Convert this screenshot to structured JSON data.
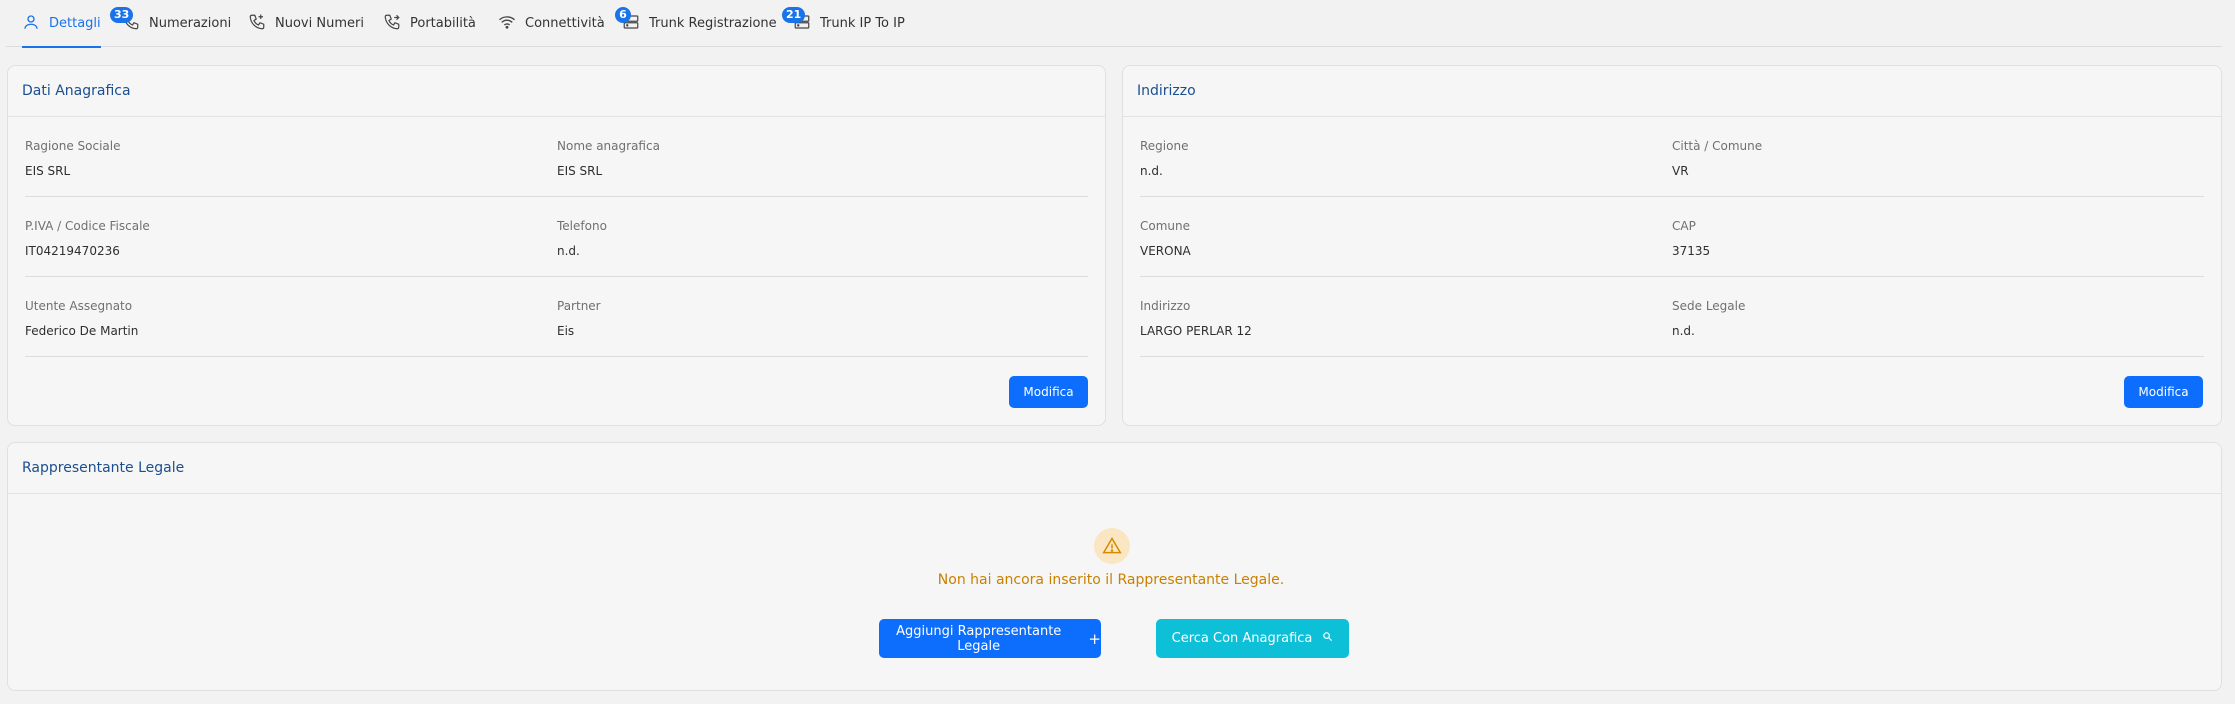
{
  "tabs": [
    {
      "label": "Dettagli",
      "icon": "user-icon",
      "badge": ""
    },
    {
      "label": "Numerazioni",
      "icon": "phone-icon",
      "badge": "33"
    },
    {
      "label": "Nuovi Numeri",
      "icon": "phone-plus-icon",
      "badge": ""
    },
    {
      "label": "Portabilità",
      "icon": "phone-forward-icon",
      "badge": ""
    },
    {
      "label": "Connettività",
      "icon": "wifi-icon",
      "badge": ""
    },
    {
      "label": "Trunk Registrazione",
      "icon": "server-icon",
      "badge": "6"
    },
    {
      "label": "Trunk IP To IP",
      "icon": "server-icon",
      "badge": "21"
    }
  ],
  "anagrafica": {
    "title": "Dati Anagrafica",
    "fields": [
      {
        "label": "Ragione Sociale",
        "value": "EIS SRL"
      },
      {
        "label": "Nome anagrafica",
        "value": "EIS SRL"
      },
      {
        "label": "P.IVA / Codice Fiscale",
        "value": "IT04219470236"
      },
      {
        "label": "Telefono",
        "value": "n.d."
      },
      {
        "label": "Utente Assegnato",
        "value": "Federico De Martin"
      },
      {
        "label": "Partner",
        "value": "Eis"
      }
    ],
    "button": "Modifica"
  },
  "indirizzo": {
    "title": "Indirizzo",
    "fields": [
      {
        "label": "Regione",
        "value": "n.d."
      },
      {
        "label": "Città / Comune",
        "value": "VR"
      },
      {
        "label": "Comune",
        "value": "VERONA"
      },
      {
        "label": "CAP",
        "value": "37135"
      },
      {
        "label": "Indirizzo",
        "value": "LARGO PERLAR 12"
      },
      {
        "label": "Sede Legale",
        "value": "n.d."
      }
    ],
    "button": "Modifica"
  },
  "rappresentante": {
    "title": "Rappresentante Legale",
    "message": "Non hai ancora inserito il Rappresentante Legale.",
    "add_button": "Aggiungi Rappresentante Legale",
    "search_button": "Cerca Con Anagrafica"
  },
  "colors": {
    "primary": "#0d6efd",
    "cyan": "#0dc0d8",
    "warning": "#c98100",
    "header_text": "#1b4f8f"
  }
}
